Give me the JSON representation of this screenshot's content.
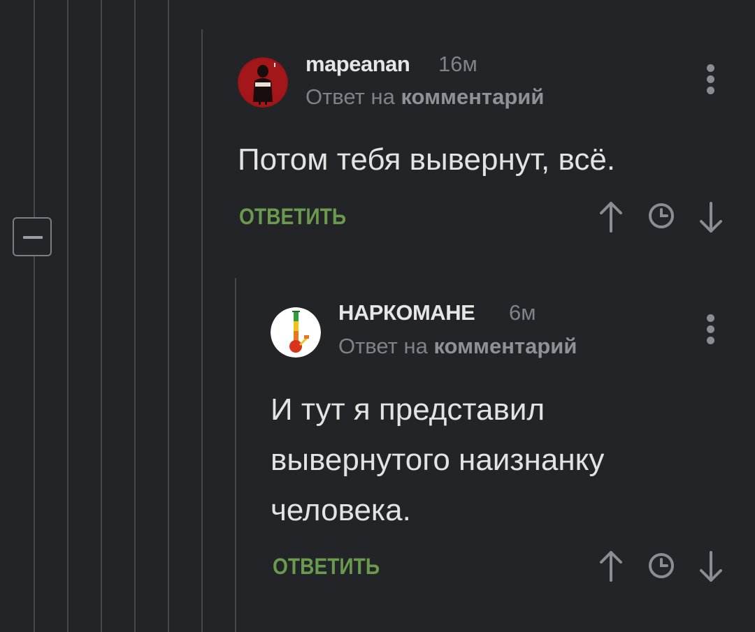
{
  "thread": {
    "collapse_icon": "minus-square-icon"
  },
  "comments": [
    {
      "author": "mapeanan",
      "time": "16м",
      "reply_prefix": "Ответ на",
      "reply_target": "комментарий",
      "body_lines": [
        "Потом тебя вывернут, всё."
      ],
      "reply_label": "ОТВЕТИТЬ",
      "avatar_colors": {
        "bg": "#9b1418",
        "figure": "#1a0d0d"
      }
    },
    {
      "author": "НАРКОМАНЕ",
      "time": "6м",
      "reply_prefix": "Ответ на",
      "reply_target": "комментарий",
      "body_lines": [
        "И тут я представил",
        "вывернутого наизнанку",
        "человека."
      ],
      "reply_label": "ОТВЕТИТЬ",
      "avatar_colors": {
        "bg": "#ffffff",
        "bong_top": "#2e9e3a",
        "bong_mid": "#f2c21b",
        "bong_bottom": "#d8341c"
      }
    }
  ],
  "colors": {
    "background": "#222427",
    "accent_green": "#6a9a4d",
    "muted": "#7f8388",
    "icon_gray": "#8a8e93"
  },
  "icons": [
    "minus-square-icon",
    "more-vertical-icon",
    "arrow-up-icon",
    "clock-icon",
    "arrow-down-icon"
  ]
}
